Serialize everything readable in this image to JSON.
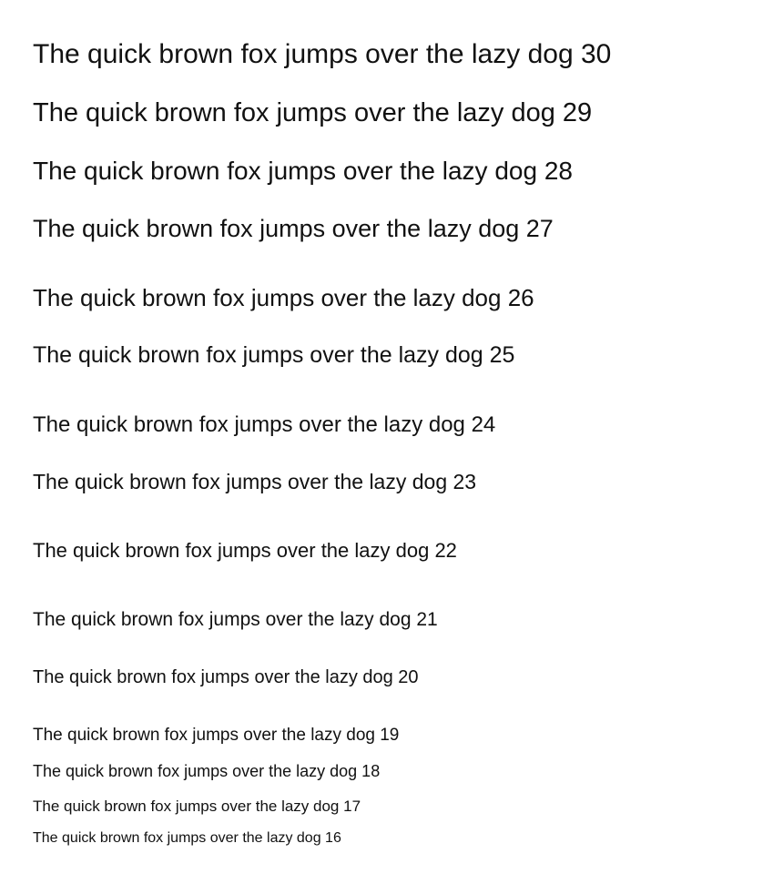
{
  "specimen": {
    "lines": [
      "The quick brown fox jumps over the lazy dog 30",
      "The quick brown fox jumps over the lazy dog 29",
      "The quick brown fox jumps over the lazy dog 28",
      "The quick brown fox jumps over the lazy dog 27",
      "The quick brown fox jumps over the lazy dog 26",
      "The quick brown fox jumps over the lazy dog 25",
      "The quick brown fox jumps over the lazy dog 24",
      "The quick brown fox jumps over the lazy dog 23",
      "The quick brown fox jumps over the lazy dog 22",
      "The quick brown fox jumps over the lazy dog 21",
      "The quick brown fox jumps over the lazy dog 20",
      "The quick brown fox jumps over the lazy dog 19",
      "The quick brown fox jumps over the lazy dog 18",
      "The quick brown fox jumps over the lazy dog 17",
      "The quick brown fox jumps over the lazy dog 16"
    ]
  }
}
